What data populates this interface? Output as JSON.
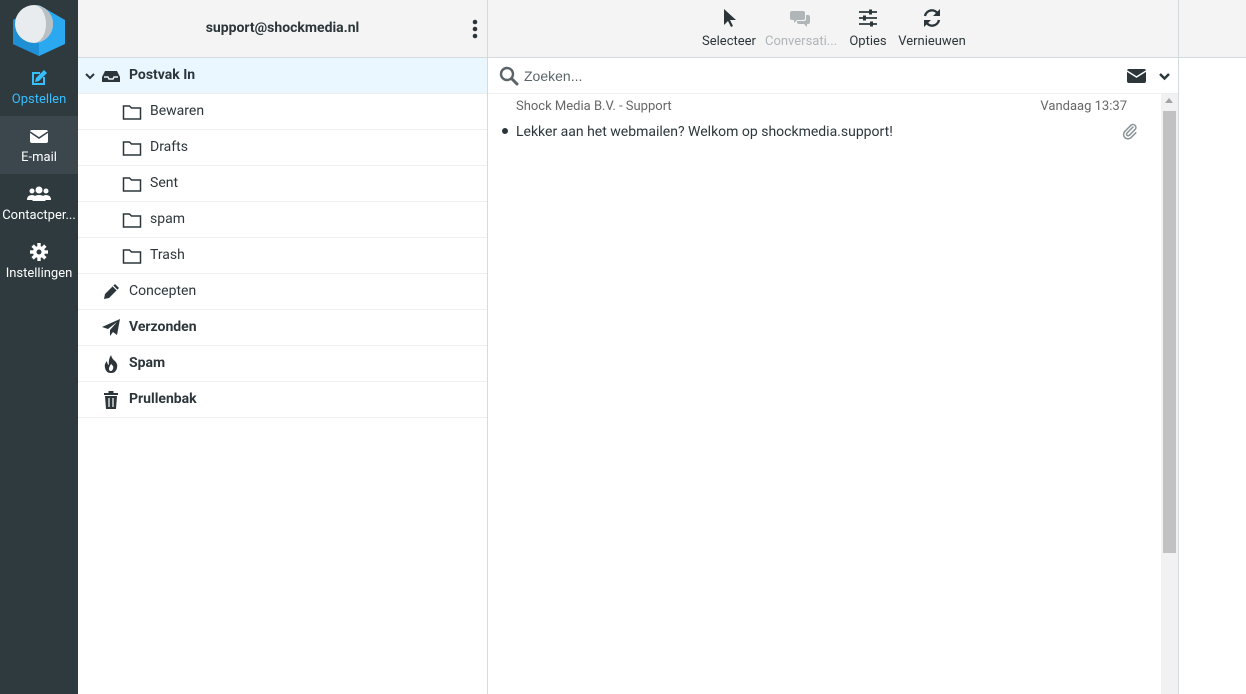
{
  "nav": {
    "compose": "Opstellen",
    "mail": "E-mail",
    "contacts": "Contactper...",
    "settings": "Instellingen"
  },
  "folders": {
    "account": "support@shockmedia.nl",
    "inbox": "Postvak In",
    "subfolders": [
      "Bewaren",
      "Drafts",
      "Sent",
      "spam",
      "Trash"
    ],
    "drafts": "Concepten",
    "sent": "Verzonden",
    "spam": "Spam",
    "trash": "Prullenbak"
  },
  "toolbar": {
    "select": "Selecteer",
    "threads": "Conversati...",
    "options": "Opties",
    "refresh": "Vernieuwen"
  },
  "search": {
    "placeholder": "Zoeken..."
  },
  "messages": [
    {
      "from": "Shock Media B.V. - Support",
      "date": "Vandaag 13:37",
      "subject": "Lekker aan het webmailen? Welkom op shockmedia.support!"
    }
  ],
  "colors": {
    "nav_bg": "#2f3a3f",
    "accent": "#37beff",
    "selected_folder_bg": "#ebf7ff"
  }
}
